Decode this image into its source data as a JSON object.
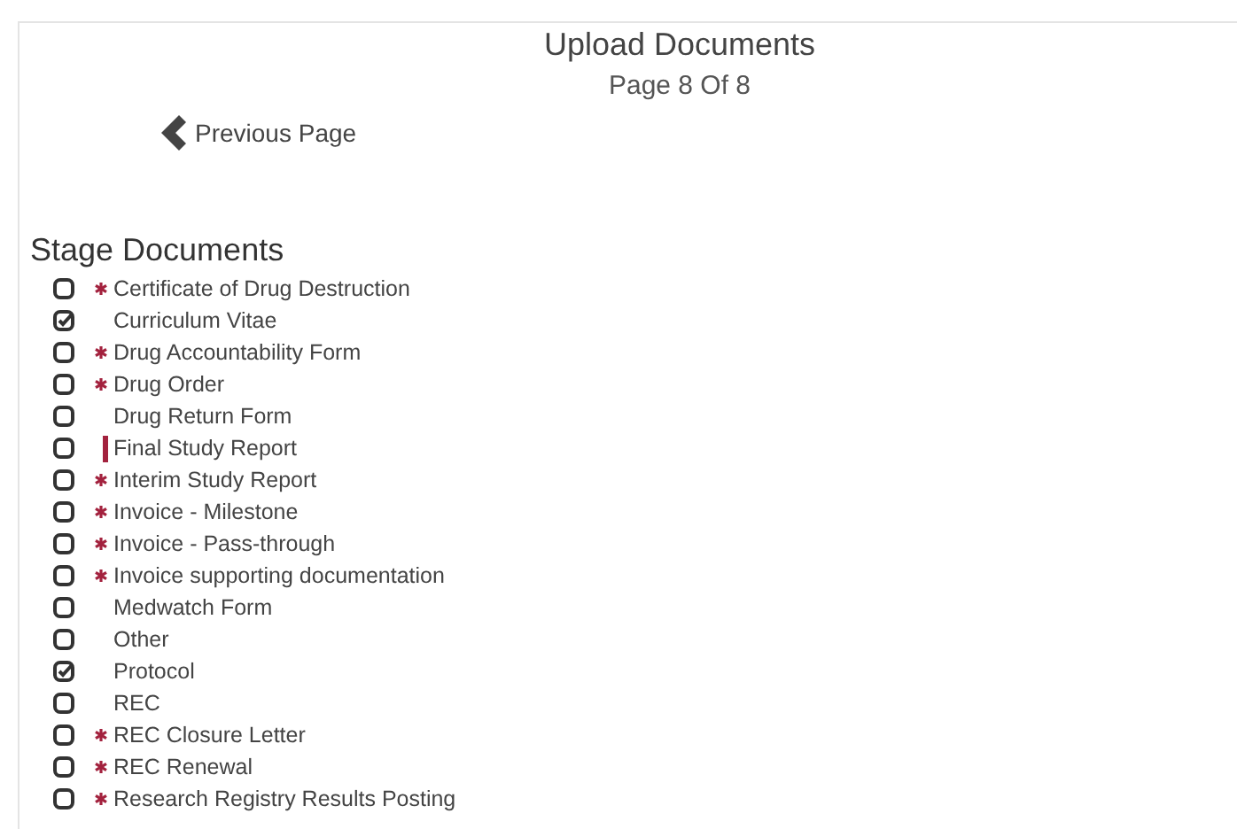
{
  "header": {
    "title": "Upload Documents",
    "page": "Page 8 Of 8"
  },
  "previous": {
    "label": "Previous Page"
  },
  "section": {
    "title": "Stage Documents"
  },
  "documents": [
    {
      "label": "Certificate of Drug Destruction",
      "checked": false,
      "kind": "required"
    },
    {
      "label": "Curriculum Vitae",
      "checked": true,
      "kind": "plain"
    },
    {
      "label": "Drug Accountability Form",
      "checked": false,
      "kind": "required"
    },
    {
      "label": "Drug Order",
      "checked": false,
      "kind": "required"
    },
    {
      "label": "Drug Return Form",
      "checked": false,
      "kind": "plain"
    },
    {
      "label": "Final Study Report",
      "checked": false,
      "kind": "flagged"
    },
    {
      "label": "Interim Study Report",
      "checked": false,
      "kind": "required"
    },
    {
      "label": "Invoice - Milestone",
      "checked": false,
      "kind": "required"
    },
    {
      "label": "Invoice - Pass-through",
      "checked": false,
      "kind": "required"
    },
    {
      "label": "Invoice supporting documentation",
      "checked": false,
      "kind": "required"
    },
    {
      "label": "Medwatch Form",
      "checked": false,
      "kind": "plain"
    },
    {
      "label": "Other",
      "checked": false,
      "kind": "plain"
    },
    {
      "label": "Protocol",
      "checked": true,
      "kind": "plain"
    },
    {
      "label": "REC",
      "checked": false,
      "kind": "plain"
    },
    {
      "label": "REC Closure Letter",
      "checked": false,
      "kind": "required"
    },
    {
      "label": "REC Renewal",
      "checked": false,
      "kind": "required"
    },
    {
      "label": "Research Registry Results Posting",
      "checked": false,
      "kind": "required"
    }
  ]
}
